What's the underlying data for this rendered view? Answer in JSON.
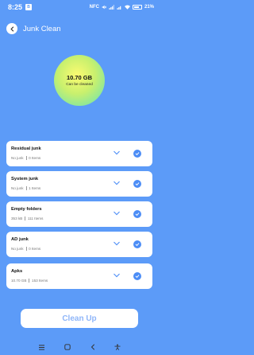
{
  "status_bar": {
    "time": "8:25",
    "app_badge": "B",
    "network_text": "NFC",
    "battery": "21%"
  },
  "header": {
    "title": "Junk Clean",
    "back_icon": "arrow-left-icon"
  },
  "summary": {
    "size": "10.70 GB",
    "caption": "Can be cleaned",
    "colors": [
      "#fcfb70",
      "#8fe898"
    ]
  },
  "categories": [
    {
      "name": "Residual junk",
      "size": "No junk",
      "count": "0 Items"
    },
    {
      "name": "System junk",
      "size": "No junk",
      "count": "1 Items"
    },
    {
      "name": "Empty folders",
      "size": "353 kB",
      "count": "111 Items"
    },
    {
      "name": "AD junk",
      "size": "No junk",
      "count": "0 Items"
    },
    {
      "name": "Apks",
      "size": "10.70 GB",
      "count": "153 Items"
    }
  ],
  "actions": {
    "clean_label": "Clean Up"
  },
  "theme": {
    "background": "#5C9BF8",
    "accent": "#4C8DF6",
    "cta_text": "#8FB6F9"
  }
}
